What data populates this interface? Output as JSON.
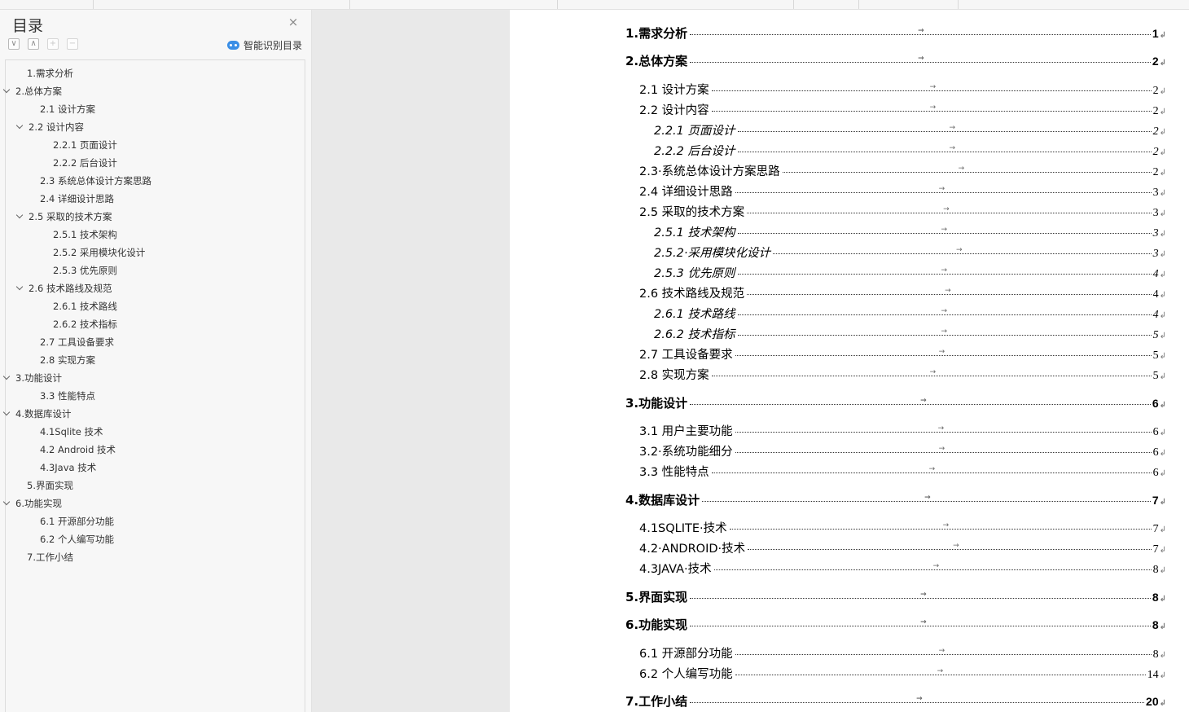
{
  "nav": {
    "title": "目录",
    "close_icon": "×",
    "tools": {
      "collapse_all": "∨",
      "expand_all": "∧",
      "add_level": "+",
      "remove_level": "−"
    },
    "smart_label": "智能识别目录",
    "items": [
      {
        "label": "1.需求分析",
        "expanded": false
      },
      {
        "label": "2.总体方案",
        "expanded": true
      },
      {
        "label": "2.1 设计方案",
        "expanded": false
      },
      {
        "label": "2.2 设计内容",
        "expanded": true
      },
      {
        "label": "2.2.1 页面设计",
        "expanded": false
      },
      {
        "label": "2.2.2 后台设计",
        "expanded": false
      },
      {
        "label": "2.3  系统总体设计方案思路",
        "expanded": false
      },
      {
        "label": "2.4 详细设计思路",
        "expanded": false
      },
      {
        "label": "2.5 采取的技术方案",
        "expanded": true
      },
      {
        "label": "2.5.1 技术架构",
        "expanded": false
      },
      {
        "label": "2.5.2  采用模块化设计",
        "expanded": false
      },
      {
        "label": "2.5.3 优先原则",
        "expanded": false
      },
      {
        "label": "2.6 技术路线及规范",
        "expanded": true
      },
      {
        "label": "2.6.1 技术路线",
        "expanded": false
      },
      {
        "label": "2.6.2 技术指标",
        "expanded": false
      },
      {
        "label": "2.7 工具设备要求",
        "expanded": false
      },
      {
        "label": "2.8 实现方案",
        "expanded": false
      },
      {
        "label": "3.功能设计",
        "expanded": true
      },
      {
        "label": "3.3 性能特点",
        "expanded": false
      },
      {
        "label": "4.数据库设计",
        "expanded": true
      },
      {
        "label": "4.1Sqlite  技术",
        "expanded": false
      },
      {
        "label": "4.2 Android  技术",
        "expanded": false
      },
      {
        "label": "4.3Java  技术",
        "expanded": false
      },
      {
        "label": "5.界面实现",
        "expanded": false
      },
      {
        "label": "6.功能实现",
        "expanded": true
      },
      {
        "label": "6.1 开源部分功能",
        "expanded": false
      },
      {
        "label": "6.2 个人编写功能",
        "expanded": false
      },
      {
        "label": "7.工作小结",
        "expanded": false
      }
    ]
  },
  "document": {
    "tab_arrow": "→",
    "paragraph_mark": "↲",
    "toc": [
      {
        "label": "1.需求分析",
        "page": "1",
        "level": 1
      },
      {
        "label": "2.总体方案",
        "page": "2",
        "level": 1
      },
      {
        "label": "2.1 设计方案",
        "page": "2",
        "level": 2
      },
      {
        "label": "2.2 设计内容",
        "page": "2",
        "level": 2
      },
      {
        "label": "2.2.1 页面设计",
        "page": "2",
        "level": 3
      },
      {
        "label": "2.2.2 后台设计",
        "page": "2",
        "level": 3
      },
      {
        "label": "2.3·系统总体设计方案思路",
        "page": "2",
        "level": 2
      },
      {
        "label": "2.4 详细设计思路",
        "page": "3",
        "level": 2
      },
      {
        "label": "2.5 采取的技术方案",
        "page": "3",
        "level": 2
      },
      {
        "label": "2.5.1 技术架构",
        "page": "3",
        "level": 3
      },
      {
        "label": "2.5.2·采用模块化设计",
        "page": "3",
        "level": 3
      },
      {
        "label": "2.5.3 优先原则",
        "page": "4",
        "level": 3
      },
      {
        "label": "2.6 技术路线及规范",
        "page": "4",
        "level": 2
      },
      {
        "label": "2.6.1 技术路线",
        "page": "4",
        "level": 3
      },
      {
        "label": "2.6.2 技术指标",
        "page": "5",
        "level": 3
      },
      {
        "label": "2.7 工具设备要求",
        "page": "5",
        "level": 2
      },
      {
        "label": "2.8 实现方案",
        "page": "5",
        "level": 2
      },
      {
        "label": "3.功能设计",
        "page": "6",
        "level": 1
      },
      {
        "label": "3.1 用户主要功能",
        "page": "6",
        "level": 2
      },
      {
        "label": "3.2·系统功能细分",
        "page": "6",
        "level": 2
      },
      {
        "label": "3.3 性能特点",
        "page": "6",
        "level": 2
      },
      {
        "label": "4.数据库设计",
        "page": "7",
        "level": 1
      },
      {
        "label": "4.1SQLITE·技术",
        "page": "7",
        "level": 2
      },
      {
        "label": "4.2·ANDROID·技术",
        "page": "7",
        "level": 2
      },
      {
        "label": "4.3JAVA·技术",
        "page": "8",
        "level": 2
      },
      {
        "label": "5.界面实现",
        "page": "8",
        "level": 1
      },
      {
        "label": "6.功能实现",
        "page": "8",
        "level": 1
      },
      {
        "label": "6.1 开源部分功能",
        "page": "8",
        "level": 2
      },
      {
        "label": "6.2 个人编写功能",
        "page": "14",
        "level": 2
      },
      {
        "label": "7.工作小结",
        "page": "20",
        "level": 1
      }
    ]
  }
}
